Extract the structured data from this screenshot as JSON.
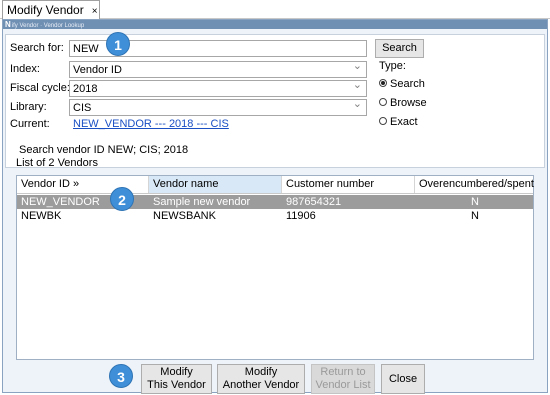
{
  "tab": {
    "title": "Modify Vendor",
    "close": "×"
  },
  "window": {
    "strip_text": "ify Vendor · Vendor Lookup",
    "strip_initial": "N"
  },
  "search": {
    "search_for_label": "Search for:",
    "search_for_value": "NEW",
    "search_button": "Search",
    "index_label": "Index:",
    "index_value": "Vendor ID",
    "fiscal_label": "Fiscal cycle:",
    "fiscal_value": "2018",
    "library_label": "Library:",
    "library_value": "CIS",
    "current_label": "Current:",
    "current_value": "NEW_VENDOR --- 2018 --- CIS"
  },
  "type_group": {
    "label": "Type:",
    "options": [
      {
        "label": "Search",
        "checked": true
      },
      {
        "label": "Browse",
        "checked": false
      },
      {
        "label": "Exact",
        "checked": false
      }
    ]
  },
  "results": {
    "summary": "Search vendor ID  NEW; CIS; 2018",
    "count_text": "List of 2 Vendors",
    "columns": [
      "Vendor ID »",
      "Vendor name",
      "Customer number",
      "Overencumbered/spent"
    ],
    "rows": [
      [
        "NEW_VENDOR",
        "Sample new vendor",
        "987654321",
        "N"
      ],
      [
        "NEWBK",
        "NEWSBANK",
        "11906",
        "N"
      ]
    ]
  },
  "buttons": {
    "modify_this_line1": "Modify",
    "modify_this_line2": "This Vendor",
    "modify_another_line1": "Modify",
    "modify_another_line2": "Another Vendor",
    "return_line1": "Return to",
    "return_line2": "Vendor List",
    "close": "Close"
  },
  "callouts": [
    "1",
    "2",
    "3"
  ],
  "colors": {
    "callout": "#3e8fd8",
    "selected_row": "#9c9c9c",
    "link": "#1a4fc4",
    "active_header": "#d8e8f7"
  }
}
